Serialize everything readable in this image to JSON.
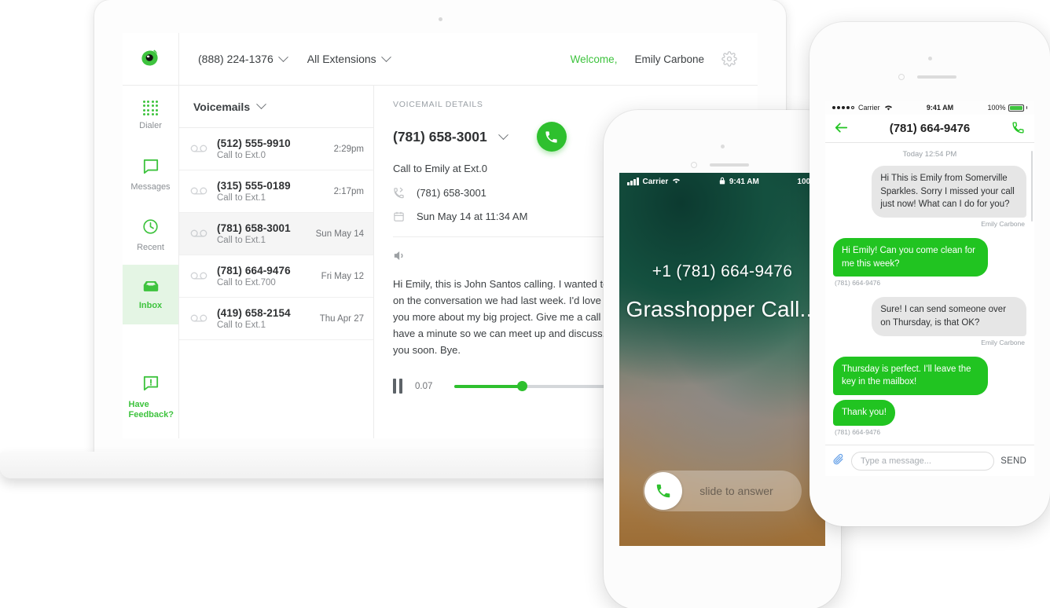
{
  "laptop_app": {
    "brand_logo": "grasshopper-logo",
    "header": {
      "phone_number": "(888) 224-1376",
      "extensions": "All Extensions",
      "welcome_label": "Welcome,",
      "user_name": "Emily Carbone",
      "settings_icon": "gear-icon"
    },
    "sidebar": {
      "items": [
        {
          "icon": "dialpad-icon",
          "label": "Dialer",
          "active": false
        },
        {
          "icon": "message-icon",
          "label": "Messages",
          "active": false
        },
        {
          "icon": "clock-icon",
          "label": "Recent",
          "active": false
        },
        {
          "icon": "inbox-icon",
          "label": "Inbox",
          "active": true
        }
      ],
      "feedback": {
        "icon": "feedback-icon",
        "line1": "Have",
        "line2": "Feedback?"
      }
    },
    "list": {
      "header": "Voicemails",
      "rows": [
        {
          "number": "(512) 555-9910",
          "sub": "Call to Ext.0",
          "time": "2:29pm",
          "selected": false
        },
        {
          "number": "(315) 555-0189",
          "sub": "Call to Ext.1",
          "time": "2:17pm",
          "selected": false
        },
        {
          "number": "(781) 658-3001",
          "sub": "Call to Ext.1",
          "time": "Sun May 14",
          "selected": true
        },
        {
          "number": "(781) 664-9476",
          "sub": "Call to Ext.700",
          "time": "Fri May 12",
          "selected": false
        },
        {
          "number": "(419) 658-2154",
          "sub": "Call to Ext.1",
          "time": "Thu Apr 27",
          "selected": false
        }
      ]
    },
    "detail": {
      "section_label": "VOICEMAIL DETAILS",
      "number": "(781) 658-3001",
      "call_to": "Call to Emily at Ext.0",
      "caller_number": "(781) 658-3001",
      "date_time": "Sun May 14 at 11:34 AM",
      "transcript": "Hi Emily, this is John Santos calling. I wanted to follow up on the conversation we had last week. I'd love to talk to you more about my big project. Give me a call when you have a minute so we can meet up and discuss. Talk to you soon. Bye.",
      "player": {
        "time": "0.07",
        "progress_percent": 33
      }
    }
  },
  "call_phone": {
    "status_bar": {
      "carrier": "Carrier",
      "time": "9:41 AM",
      "battery": "100%"
    },
    "caller_number": "+1 (781) 664-9476",
    "caller_name": "Grasshopper Call...",
    "slide_label": "slide to answer"
  },
  "message_phone": {
    "status_bar": {
      "carrier": "Carrier",
      "time": "9:41 AM",
      "battery": "100%"
    },
    "nav": {
      "back_icon": "back-arrow-icon",
      "title": "(781) 664-9476",
      "call_icon": "phone-icon"
    },
    "date_divider": "Today 12:54 PM",
    "messages": [
      {
        "side": "them",
        "text": "Hi This is Emily from Somerville Sparkles. Sorry I missed your call just now! What can I do for you?",
        "meta": "Emily Carbone"
      },
      {
        "side": "me",
        "text": "Hi Emily! Can you come clean for me this week?",
        "meta": "(781) 664-9476"
      },
      {
        "side": "them",
        "text": "Sure! I can send someone over on Thursday, is that OK?",
        "meta": "Emily Carbone"
      },
      {
        "side": "me",
        "text": "Thursday is perfect. I'll leave the key in the mailbox!",
        "meta": ""
      },
      {
        "side": "me",
        "text": "Thank you!",
        "meta": "(781) 664-9476"
      }
    ],
    "composer": {
      "attach_icon": "paperclip-icon",
      "placeholder": "Type a message...",
      "send_label": "SEND"
    }
  },
  "colors": {
    "brand_green": "#3ec33e",
    "call_green": "#2ec02e",
    "bubble_green": "#21c421",
    "bubble_gray": "#e6e6e6",
    "text_dark": "#3c4043",
    "text_muted": "#9aa0a6"
  }
}
